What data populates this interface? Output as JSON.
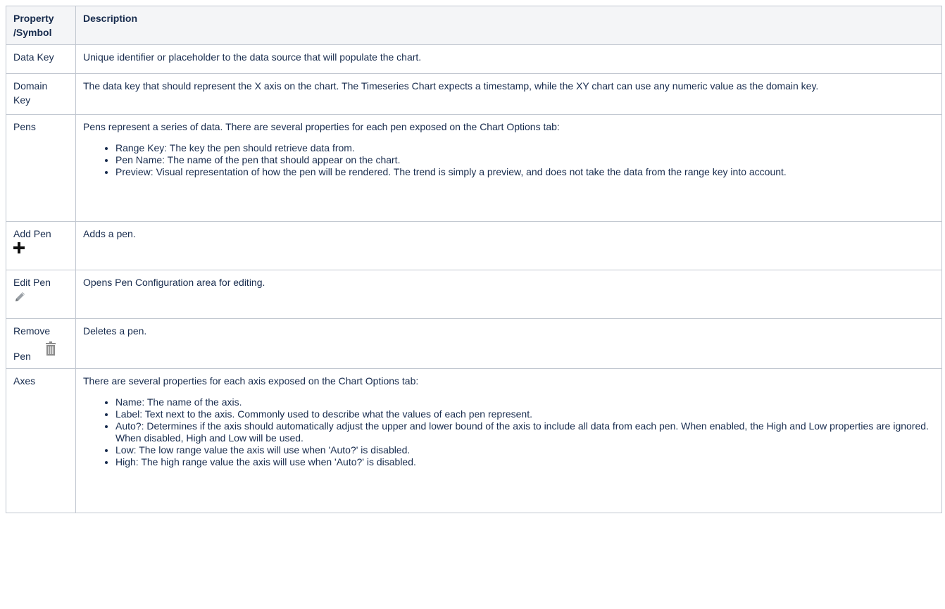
{
  "header": {
    "property_line1": "Property",
    "property_line2": "/Symbol",
    "description": "Description"
  },
  "rows": [
    {
      "property": "Data Key",
      "description": "Unique identifier or placeholder to the data source that will populate the chart."
    },
    {
      "property_line1": "Domain",
      "property_line2": "Key",
      "description": "The data key that should represent the X axis on the chart. The Timeseries Chart expects a timestamp, while the XY chart can use any numeric value as the domain key."
    },
    {
      "property": "Pens",
      "description": "Pens represent a series of data. There are several properties for each pen exposed on the Chart Options tab:",
      "bullets": [
        "Range Key: The key the pen should retrieve data from.",
        "Pen Name: The name of the pen that should appear on the chart.",
        "Preview: Visual representation of how the pen will be rendered. The trend is simply a preview, and does not take the data from the range key into account."
      ]
    },
    {
      "property": "Add Pen",
      "icon": "plus-icon",
      "description": "Adds a pen."
    },
    {
      "property": "Edit Pen",
      "icon": "pencil-icon",
      "description": "Opens Pen Configuration area for editing."
    },
    {
      "property_line1": "Remove",
      "property_line2": "Pen",
      "icon": "trash-icon",
      "description": "Deletes a pen."
    },
    {
      "property": "Axes",
      "description": "There are several properties for each axis exposed on the Chart Options tab:",
      "bullets": [
        "Name: The name of the axis.",
        "Label: Text next to the axis. Commonly used to describe what the values of each pen represent.",
        "Auto?: Determines if the axis should automatically adjust the upper and lower bound of the axis to include all data from each pen. When enabled, the High and Low properties are ignored. When disabled, High and Low will be used.",
        "Low: The low range value the axis will use when 'Auto?' is disabled.",
        "High: The high range value the axis will use when 'Auto?' is disabled."
      ]
    }
  ],
  "colors": {
    "border": "#c1c7d0",
    "header_bg": "#f4f5f7",
    "text": "#172b4d",
    "icon_gray": "#8c8c8c"
  }
}
